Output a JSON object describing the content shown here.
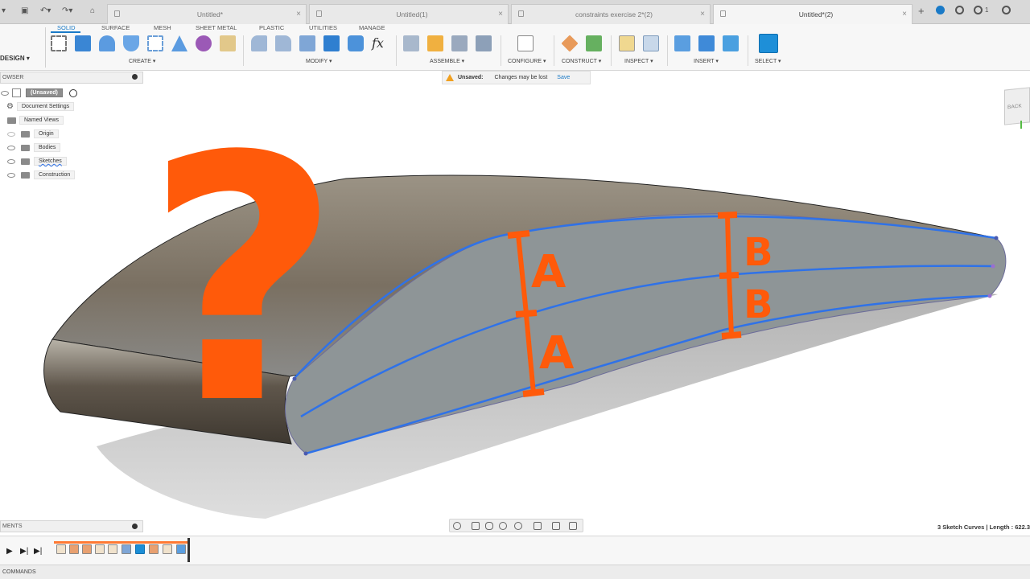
{
  "tabs": [
    {
      "label": "Untitled*",
      "active": false
    },
    {
      "label": "Untitled(1)",
      "active": false
    },
    {
      "label": "constraints exercise 2*(2)",
      "active": false
    },
    {
      "label": "Untitled*(2)",
      "active": true
    }
  ],
  "workspace": {
    "label": "DESIGN ▾"
  },
  "ws_tabs": [
    "SOLID",
    "SURFACE",
    "MESH",
    "SHEET METAL",
    "PLASTIC",
    "UTILITIES",
    "MANAGE"
  ],
  "toolbar_groups": [
    "CREATE ▾",
    "MODIFY ▾",
    "ASSEMBLE ▾",
    "CONFIGURE ▾",
    "CONSTRUCT ▾",
    "INSPECT ▾",
    "INSERT ▾",
    "SELECT ▾"
  ],
  "browser": {
    "title": "OWSER",
    "items": [
      {
        "label": "(Unsaved)"
      },
      {
        "label": "Document Settings"
      },
      {
        "label": "Named Views"
      },
      {
        "label": "Origin"
      },
      {
        "label": "Bodies"
      },
      {
        "label": "Sketches"
      },
      {
        "label": "Construction"
      }
    ]
  },
  "unsaved_bar": {
    "label": "Unsaved:",
    "message": "Changes may be lost",
    "save": "Save"
  },
  "view_cube": {
    "face": "BACK"
  },
  "annotations": {
    "question": "?",
    "a": "A",
    "b": "B"
  },
  "comments": {
    "title": "MENTS"
  },
  "status": {
    "text": "3 Sketch Curves | Length : 622.3"
  },
  "commands": {
    "label": "COMMANDS"
  },
  "colors": {
    "accent": "#1a7ac7",
    "annotation": "#ff5a0a",
    "curve": "#2f72e8",
    "timeline": "#ff7a33"
  }
}
